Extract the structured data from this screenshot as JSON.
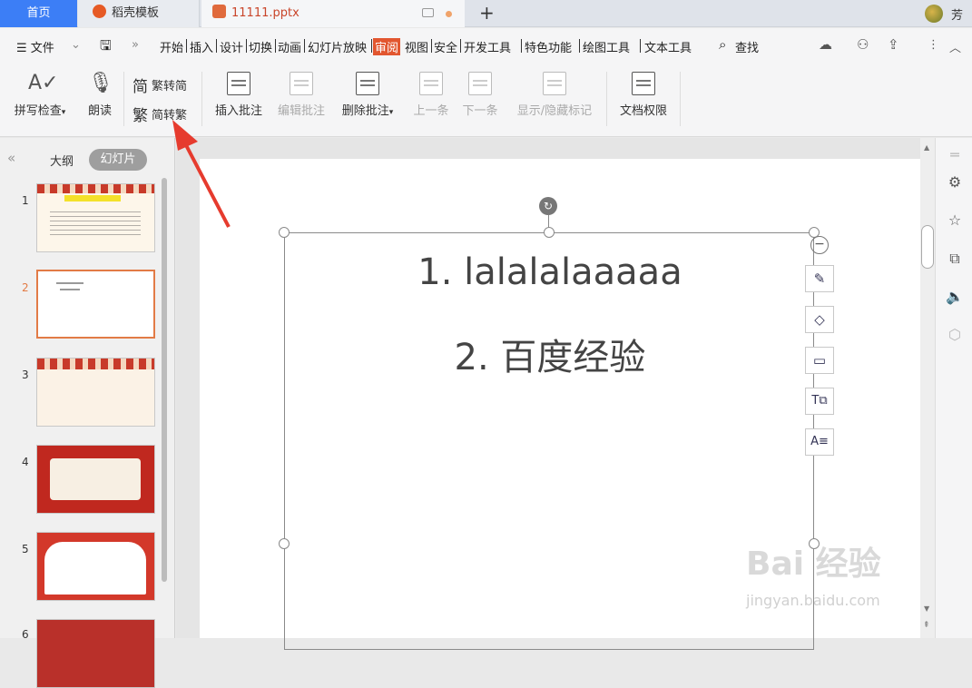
{
  "tabs": {
    "home": "首页",
    "docer": "稻壳模板",
    "file": "11111.pptx",
    "new_tab": "+"
  },
  "user": {
    "name": "芳"
  },
  "menu": {
    "file": "☰ 文件",
    "items": [
      "开始",
      "插入",
      "设计",
      "切换",
      "动画",
      "幻灯片放映",
      "审阅",
      "视图",
      "安全",
      "开发工具",
      "特色功能",
      "绘图工具",
      "文本工具"
    ],
    "active": "审阅",
    "search": "查找"
  },
  "ribbon": {
    "spell_check": "拼写检查",
    "read_aloud": "朗读",
    "trad_to_simp": "繁转简",
    "simp_to_trad": "简转繁",
    "insert_comment": "插入批注",
    "edit_comment": "编辑批注",
    "delete_comment": "删除批注",
    "prev": "上一条",
    "next": "下一条",
    "show_hide_markup": "显示/隐藏标记",
    "doc_permission": "文档权限"
  },
  "left_panel": {
    "outline_tab": "大纲",
    "slides_tab": "幻灯片",
    "slides": [
      "1",
      "2",
      "3",
      "4",
      "5",
      "6"
    ],
    "selected": "2"
  },
  "slide_content": {
    "line1": "1.  lalalalaaaaa",
    "line2": "2.  百度经验"
  },
  "watermark": {
    "brand": "Bai 经验",
    "url": "jingyan.baidu.com"
  },
  "colors": {
    "accent_blue": "#3c7ef6",
    "review_active": "#e2562f",
    "selection_orange": "#e27b46",
    "annotation_arrow": "#e63b2e"
  }
}
